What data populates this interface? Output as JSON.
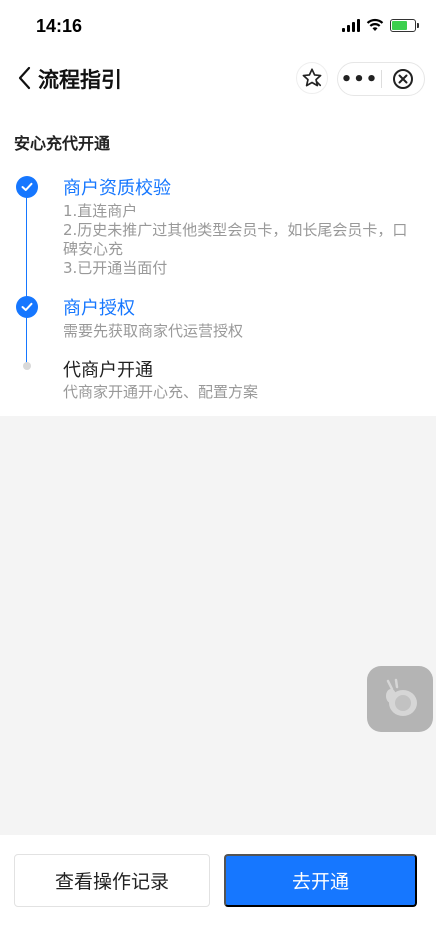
{
  "status_bar": {
    "time": "14:16",
    "icons": [
      "signal-icon",
      "wifi-icon",
      "battery-charging-icon"
    ]
  },
  "nav": {
    "title": "流程指引",
    "icons": [
      "chevron-left-icon",
      "star-icon",
      "more-icon",
      "close-circle-icon"
    ],
    "more_label": "•••"
  },
  "section": {
    "title": "安心充代开通"
  },
  "steps": [
    {
      "title": "商户资质校验",
      "status": "done",
      "desc": [
        "1.直连商户",
        "2.历史未推广过其他类型会员卡，如长尾会员卡，口碑安心充",
        "3.已开通当面付"
      ]
    },
    {
      "title": "商户授权",
      "status": "done",
      "desc": [
        "需要先获取商家代运营授权"
      ]
    },
    {
      "title": "代商户开通",
      "status": "pending",
      "desc": [
        "代商家开通开心充、配置方案"
      ]
    }
  ],
  "footer": {
    "records_label": "查看操作记录",
    "open_label": "去开通"
  },
  "colors": {
    "accent": "#1677ff",
    "floating_ball": "#b4b4b4"
  }
}
